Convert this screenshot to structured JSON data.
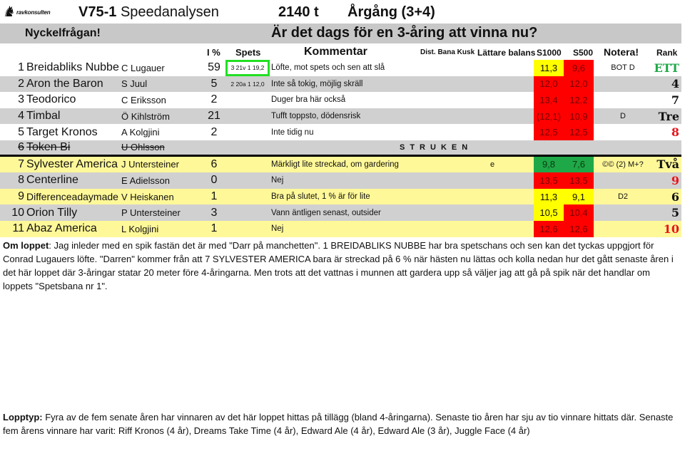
{
  "logo": {
    "icon": "horse-icon",
    "text": "ravkonsulten"
  },
  "header": {
    "race": "V75-1",
    "title": "Speedanalysen",
    "distance": "2140 t",
    "class": "Årgång (3+4)"
  },
  "key_question": {
    "label": "Nyckelfrågan!",
    "question": "Är det dags för en 3-åring att vinna nu?"
  },
  "columns": {
    "ipct": "I %",
    "spets": "Spets",
    "kommentar": "Kommentar",
    "dist_bana_kusk": "Dist. Bana Kusk",
    "lattare_balans": "Lättare balans",
    "s1000": "S1000",
    "s500": "S500",
    "notera": "Notera!",
    "rank": "Rank"
  },
  "colors": {
    "yellow_cell": "#ffff00",
    "red_cell": "#ff0000",
    "green_cell": "#1fa847",
    "row_gray": "#d0d0d0",
    "row_yellow": "#fff899",
    "highlight_box": "#22e022",
    "rank_green": "#1fa847",
    "rank_red": "#e8141b"
  },
  "horses": [
    {
      "num": "1",
      "name": "Breidabliks Nubbe",
      "driver": "C Lugauer",
      "pct": "59",
      "spets": "3 21v 1 19,2",
      "comment": "Löfte, mot spets och sen att slå",
      "extra": "",
      "s1000": "11,3",
      "s1000_color": "yellow",
      "s500": "9,6",
      "s500_color": "red",
      "note": "BOT D",
      "rank": "ETT",
      "rank_color": "#1fa847"
    },
    {
      "num": "2",
      "name": "Aron the Baron",
      "driver": "S Juul",
      "pct": "5",
      "spets": "2 20a 1 12,0",
      "comment": "Inte så tokig, möjlig skräll",
      "extra": "",
      "s1000": "12,0",
      "s1000_color": "red",
      "s500": "12,0",
      "s500_color": "red",
      "note": "",
      "rank": "4",
      "rank_color": "#111111"
    },
    {
      "num": "3",
      "name": "Teodorico",
      "driver": "C Eriksson",
      "pct": "2",
      "spets": "",
      "comment": "Duger bra här också",
      "extra": "",
      "s1000": "13,4",
      "s1000_color": "red",
      "s500": "12,2",
      "s500_color": "red",
      "note": "",
      "rank": "7",
      "rank_color": "#111111"
    },
    {
      "num": "4",
      "name": "Timbal",
      "driver": "Ö Kihlström",
      "pct": "21",
      "spets": "",
      "comment": "Tufft toppsto, dödensrisk",
      "extra": "",
      "s1000": "(12,1)",
      "s1000_color": "red",
      "s500": "10,9",
      "s500_color": "red",
      "note": "D",
      "rank": "Tre",
      "rank_color": "#111111"
    },
    {
      "num": "5",
      "name": "Target Kronos",
      "driver": "A Kolgjini",
      "pct": "2",
      "spets": "",
      "comment": "Inte tidig nu",
      "extra": "",
      "s1000": "12,5",
      "s1000_color": "red",
      "s500": "12,5",
      "s500_color": "red",
      "note": "",
      "rank": "8",
      "rank_color": "#e8141b"
    },
    {
      "num": "6",
      "name": "Token Bi",
      "driver": "U Ohlsson",
      "pct": "",
      "spets": "",
      "comment": "",
      "struck": true,
      "struck_label": "STRUKEN",
      "extra": "",
      "s1000": "",
      "s500": "",
      "note": "",
      "rank": ""
    },
    {
      "num": "7",
      "name": "Sylvester America",
      "driver": "J Untersteiner",
      "pct": "6",
      "spets": "",
      "comment": "Märkligt lite streckad, om gardering",
      "extra": "e",
      "s1000": "9,8",
      "s1000_color": "green",
      "s500": "7,6",
      "s500_color": "green",
      "note": "©© (2) M+?",
      "rank": "Två",
      "rank_color": "#111111"
    },
    {
      "num": "8",
      "name": "Centerline",
      "driver": "E Adielsson",
      "pct": "0",
      "spets": "",
      "comment": "Nej",
      "extra": "",
      "s1000": "13,5",
      "s1000_color": "red",
      "s500": "13,5",
      "s500_color": "red",
      "note": "",
      "rank": "9",
      "rank_color": "#e8141b"
    },
    {
      "num": "9",
      "name": "Differenceadaymade",
      "driver": "V Heiskanen",
      "pct": "1",
      "spets": "",
      "comment": "Bra på slutet, 1 % är för lite",
      "extra": "",
      "s1000": "11,3",
      "s1000_color": "yellow",
      "s500": "9,1",
      "s500_color": "yellow",
      "note": "D2",
      "rank": "6",
      "rank_color": "#111111"
    },
    {
      "num": "10",
      "name": "Orion Tilly",
      "driver": "P Untersteiner",
      "pct": "3",
      "spets": "",
      "comment": "Vann äntligen senast, outsider",
      "extra": "",
      "s1000": "10,5",
      "s1000_color": "yellow",
      "s500": "10,4",
      "s500_color": "red",
      "note": "",
      "rank": "5",
      "rank_color": "#111111"
    },
    {
      "num": "11",
      "name": "Abaz America",
      "driver": "L Kolgjini",
      "pct": "1",
      "spets": "",
      "comment": "Nej",
      "extra": "",
      "s1000": "12,6",
      "s1000_color": "red",
      "s500": "12,6",
      "s500_color": "red",
      "note": "",
      "rank": "10",
      "rank_color": "#e8141b"
    }
  ],
  "om_loppet": {
    "label": "Om loppet",
    "text": ": Jag inleder med en spik fastän det är med \"Darr på manchetten\". 1 BREIDABLIKS NUBBE har bra spetschans och sen kan det tyckas uppgjort för Conrad Lugauers löfte. \"Darren\" kommer från att 7 SYLVESTER AMERICA bara är streckad på 6 % när hästen nu lättas och kolla nedan hur det gått senaste åren i det här loppet där 3-åringar statar 20 meter före 4-åringarna. Men trots att det vattnas i munnen att gardera upp så väljer jag att gå på spik när det handlar om loppets \"Spetsbana nr 1\"."
  },
  "lopptyp": {
    "label": "Lopptyp:",
    "text": " Fyra av de fem senate åren har vinnaren av det här loppet hittas på tillägg (bland 4-åringarna). Senaste tio åren har sju av tio vinnare hittats där. Senaste fem årens vinnare har varit: Riff Kronos (4 år), Dreams Take Time (4 år), Edward Ale (4 år), Edward Ale (3 år), Juggle Face (4 år)"
  }
}
